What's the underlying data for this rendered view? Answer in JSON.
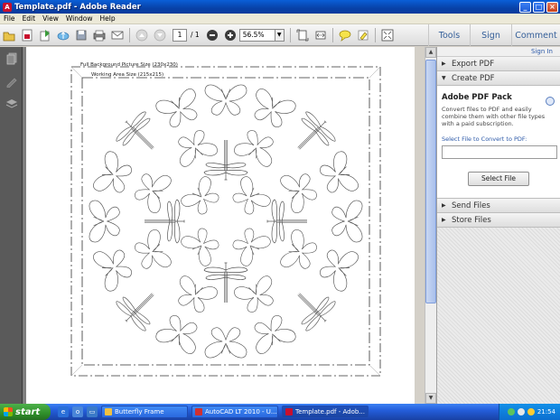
{
  "window": {
    "title": "Template.pdf - Adobe Reader",
    "minimize": "_",
    "maximize": "□",
    "close": "×"
  },
  "menu": [
    "File",
    "Edit",
    "View",
    "Window",
    "Help"
  ],
  "toolbar": {
    "page_current": "1",
    "page_total": "/ 1",
    "zoom": "56.5%",
    "tabs": [
      "Tools",
      "Sign",
      "Comment"
    ]
  },
  "document": {
    "label_full": "Full Background Picture Size (230x230)",
    "label_working": "Working Area Size (215x215)"
  },
  "right_panel": {
    "sign_in": "Sign In",
    "export_pdf": "Export PDF",
    "create_pdf": "Create PDF",
    "pack_title": "Adobe PDF Pack",
    "pack_desc": "Convert files to PDF and easily combine them with other file types with a paid subscription.",
    "select_label": "Select File to Convert to PDF:",
    "select_button": "Select File",
    "send_files": "Send Files",
    "store_files": "Store Files"
  },
  "taskbar": {
    "start": "start",
    "tasks": [
      {
        "label": "Butterfly Frame",
        "active": false
      },
      {
        "label": "AutoCAD LT 2010 - U...",
        "active": false
      },
      {
        "label": "Template.pdf - Adob...",
        "active": true
      }
    ],
    "clock": "21:54"
  },
  "colors": {
    "xp_blue": "#245edb",
    "adobe_red": "#c8102e",
    "link_blue": "#2c59a8"
  }
}
